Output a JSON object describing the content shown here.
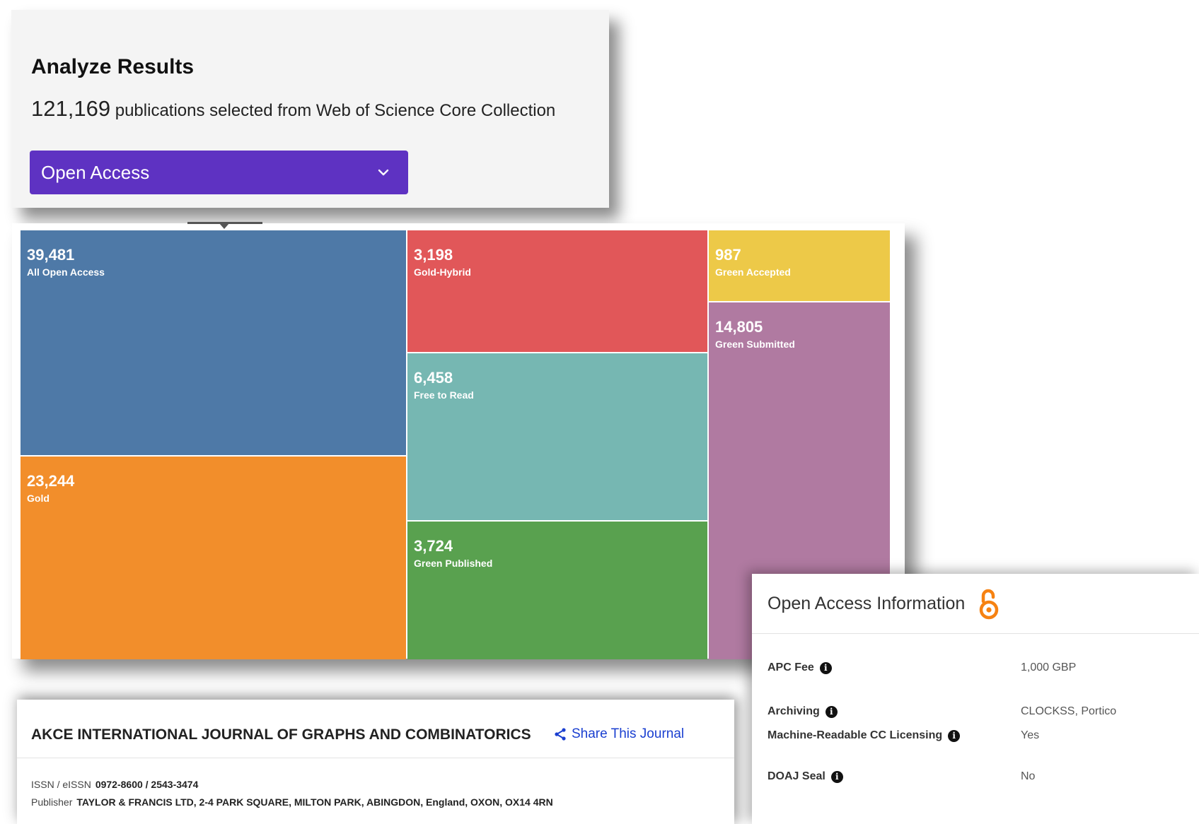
{
  "analyze": {
    "title": "Analyze Results",
    "count": "121,169",
    "subtitle": "publications selected from Web of Science Core Collection",
    "dropdown": {
      "selected": "Open Access",
      "icon": "chevron-down-icon"
    }
  },
  "chart_data": {
    "type": "treemap",
    "items": [
      {
        "label": "All Open Access",
        "display": "39,481",
        "value": 39481,
        "color": "#4e79a7"
      },
      {
        "label": "Gold",
        "display": "23,244",
        "value": 23244,
        "color": "#f28e2b"
      },
      {
        "label": "Gold-Hybrid",
        "display": "3,198",
        "value": 3198,
        "color": "#e15759"
      },
      {
        "label": "Free to Read",
        "display": "6,458",
        "value": 6458,
        "color": "#76b7b2"
      },
      {
        "label": "Green Published",
        "display": "3,724",
        "value": 3724,
        "color": "#59a14f"
      },
      {
        "label": "Green Accepted",
        "display": "987",
        "value": 987,
        "color": "#edc948"
      },
      {
        "label": "Green Submitted",
        "display": "14,805",
        "value": 14805,
        "color": "#b07aa1"
      }
    ]
  },
  "journal": {
    "title": "AKCE INTERNATIONAL JOURNAL OF GRAPHS AND COMBINATORICS",
    "share_label": "Share This Journal",
    "issn_label": "ISSN / eISSN",
    "issn_value": "0972-8600 / 2543-3474",
    "publisher_label": "Publisher",
    "publisher_value": "TAYLOR & FRANCIS LTD, 2-4 PARK SQUARE, MILTON PARK, ABINGDON, England, OXON, OX14 4RN"
  },
  "oa_info": {
    "title": "Open Access Information",
    "rows": [
      {
        "label": "APC Fee",
        "value": "1,000 GBP"
      },
      {
        "label": "Archiving",
        "value": "CLOCKSS, Portico"
      },
      {
        "label": "Machine-Readable CC Licensing",
        "value": "Yes"
      },
      {
        "label": "DOAJ Seal",
        "value": "No"
      }
    ]
  }
}
